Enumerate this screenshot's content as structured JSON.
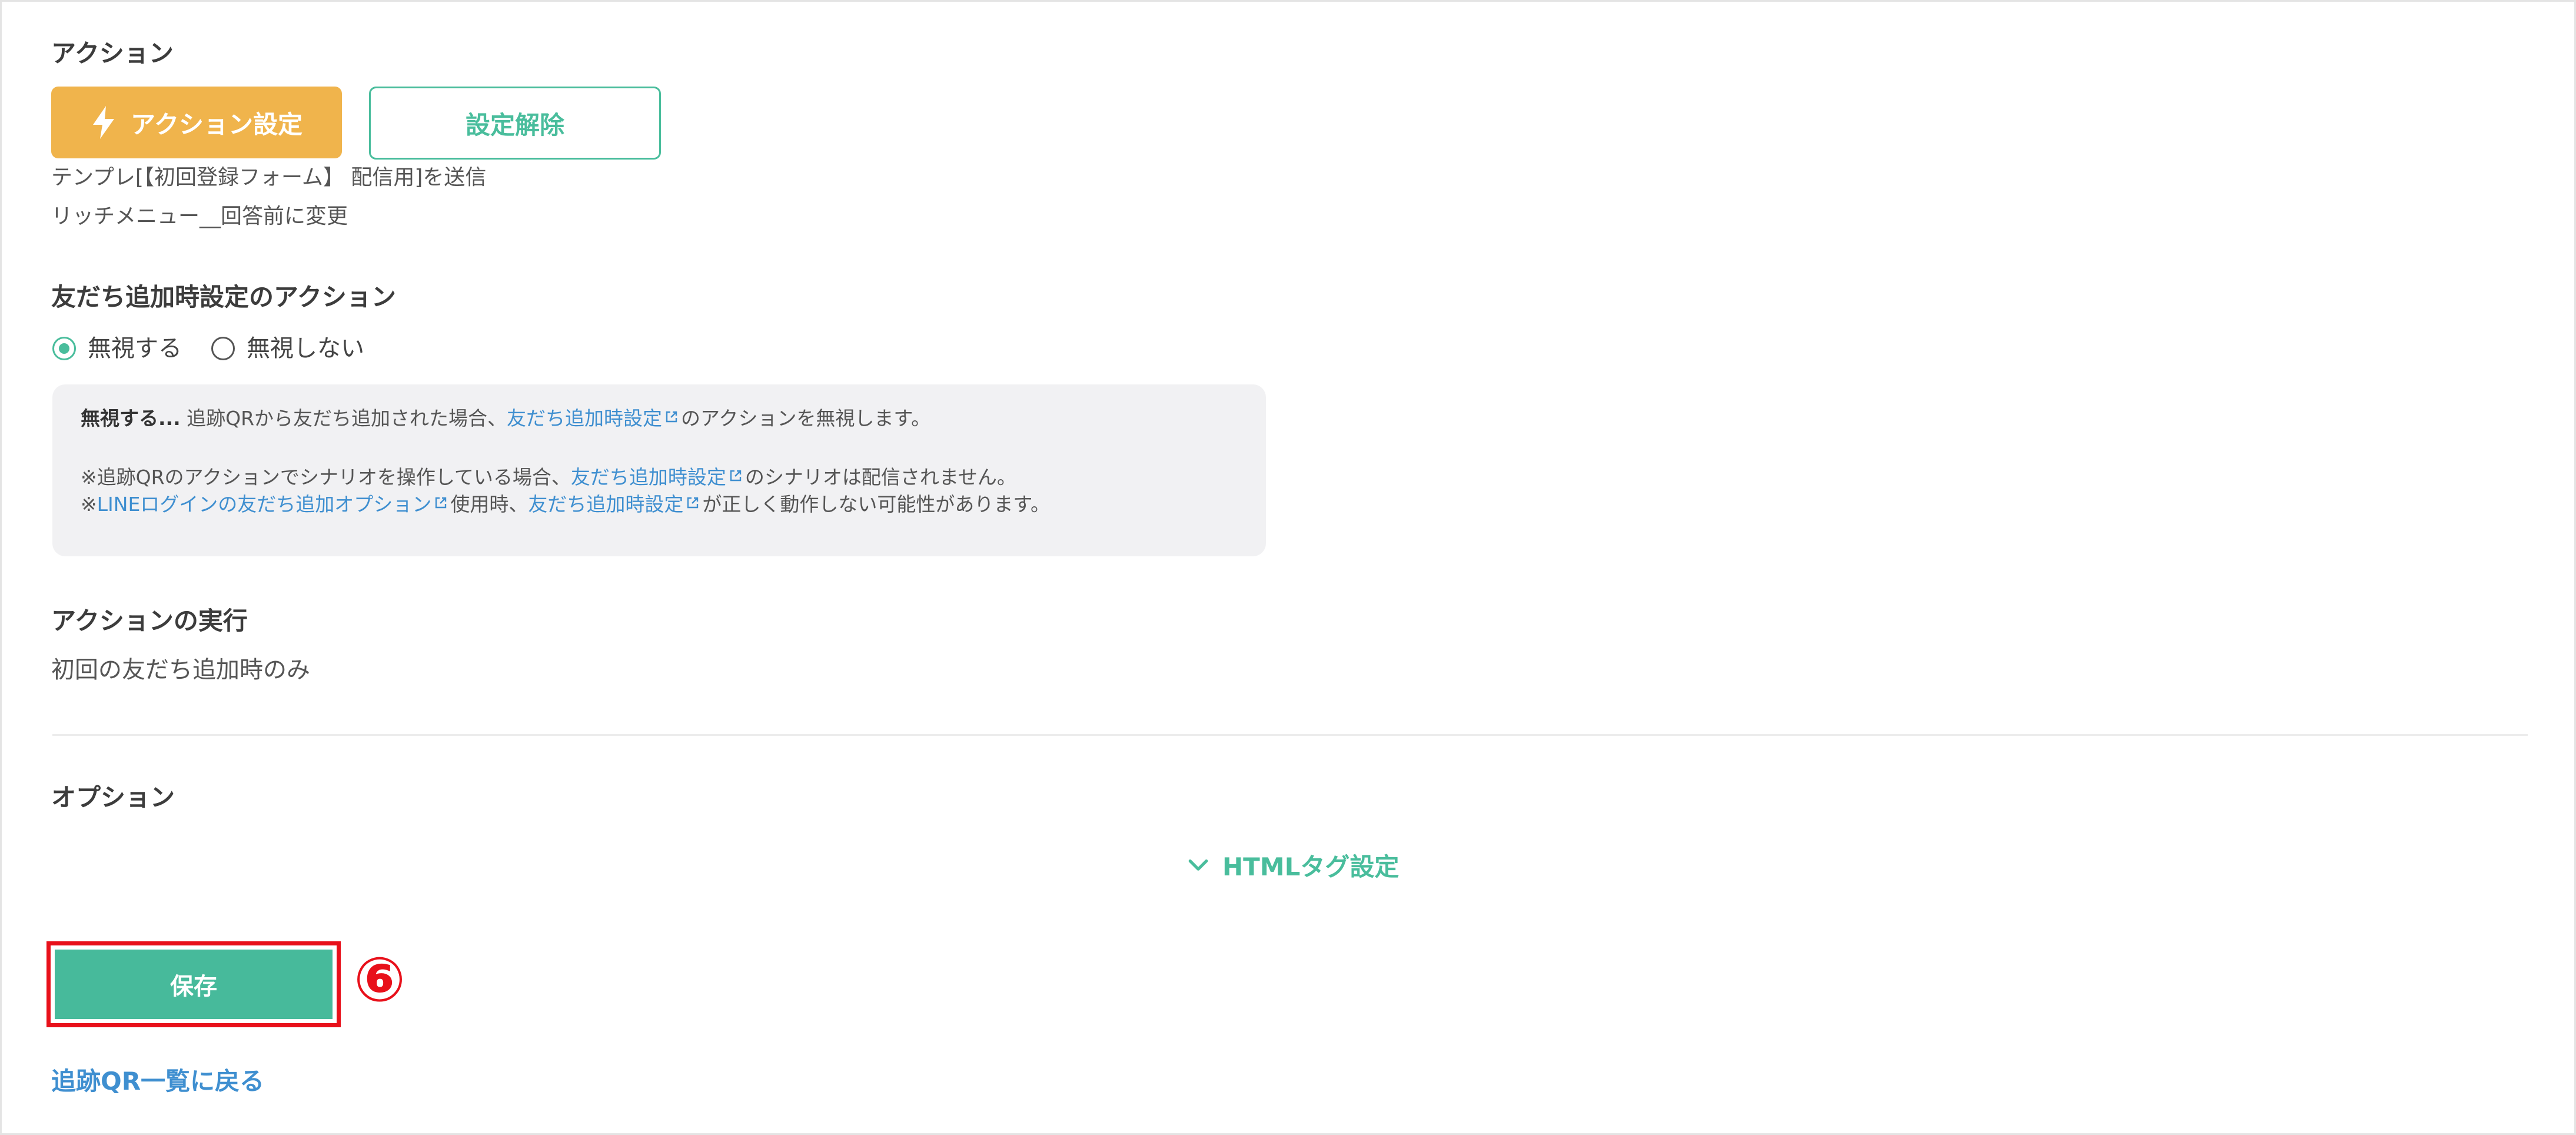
{
  "action_section": {
    "heading": "アクション",
    "set_button": "アクション設定",
    "clear_button": "設定解除",
    "summary_lines": [
      "テンプレ[【初回登録フォーム】 配信用]を送信",
      "リッチメニュー__回答前に変更"
    ]
  },
  "friend_add_section": {
    "heading": "友だち追加時設定のアクション",
    "options": [
      "無視する",
      "無視しない"
    ],
    "selected": "無視する",
    "note": {
      "line1_bold": "無視する...",
      "line1_text": " 追跡QRから友だち追加された場合、",
      "line1_link": "友だち追加時設定",
      "line1_tail": "のアクションを無視します。",
      "line2_text": "※追跡QRのアクションでシナリオを操作している場合、",
      "line2_link": "友だち追加時設定",
      "line2_tail": "のシナリオは配信されません。",
      "line3_prefix": "※",
      "line3_link1": "LINEログインの友だち追加オプション",
      "line3_mid": "使用時、",
      "line3_link2": "友だち追加時設定",
      "line3_tail": "が正しく動作しない可能性があります。"
    }
  },
  "execution_section": {
    "heading": "アクションの実行",
    "value": "初回の友だち追加時のみ"
  },
  "option_section": {
    "heading": "オプション",
    "html_tag_toggle": "HTMLタグ設定"
  },
  "footer": {
    "save_button": "保存",
    "step_marker": "⑥",
    "back_link": "追跡QR一覧に戻る"
  },
  "colors": {
    "accent_green": "#49bd9c",
    "action_orange": "#f0b44c",
    "link_blue": "#3f8fd0",
    "highlight_red": "#e8101a"
  }
}
